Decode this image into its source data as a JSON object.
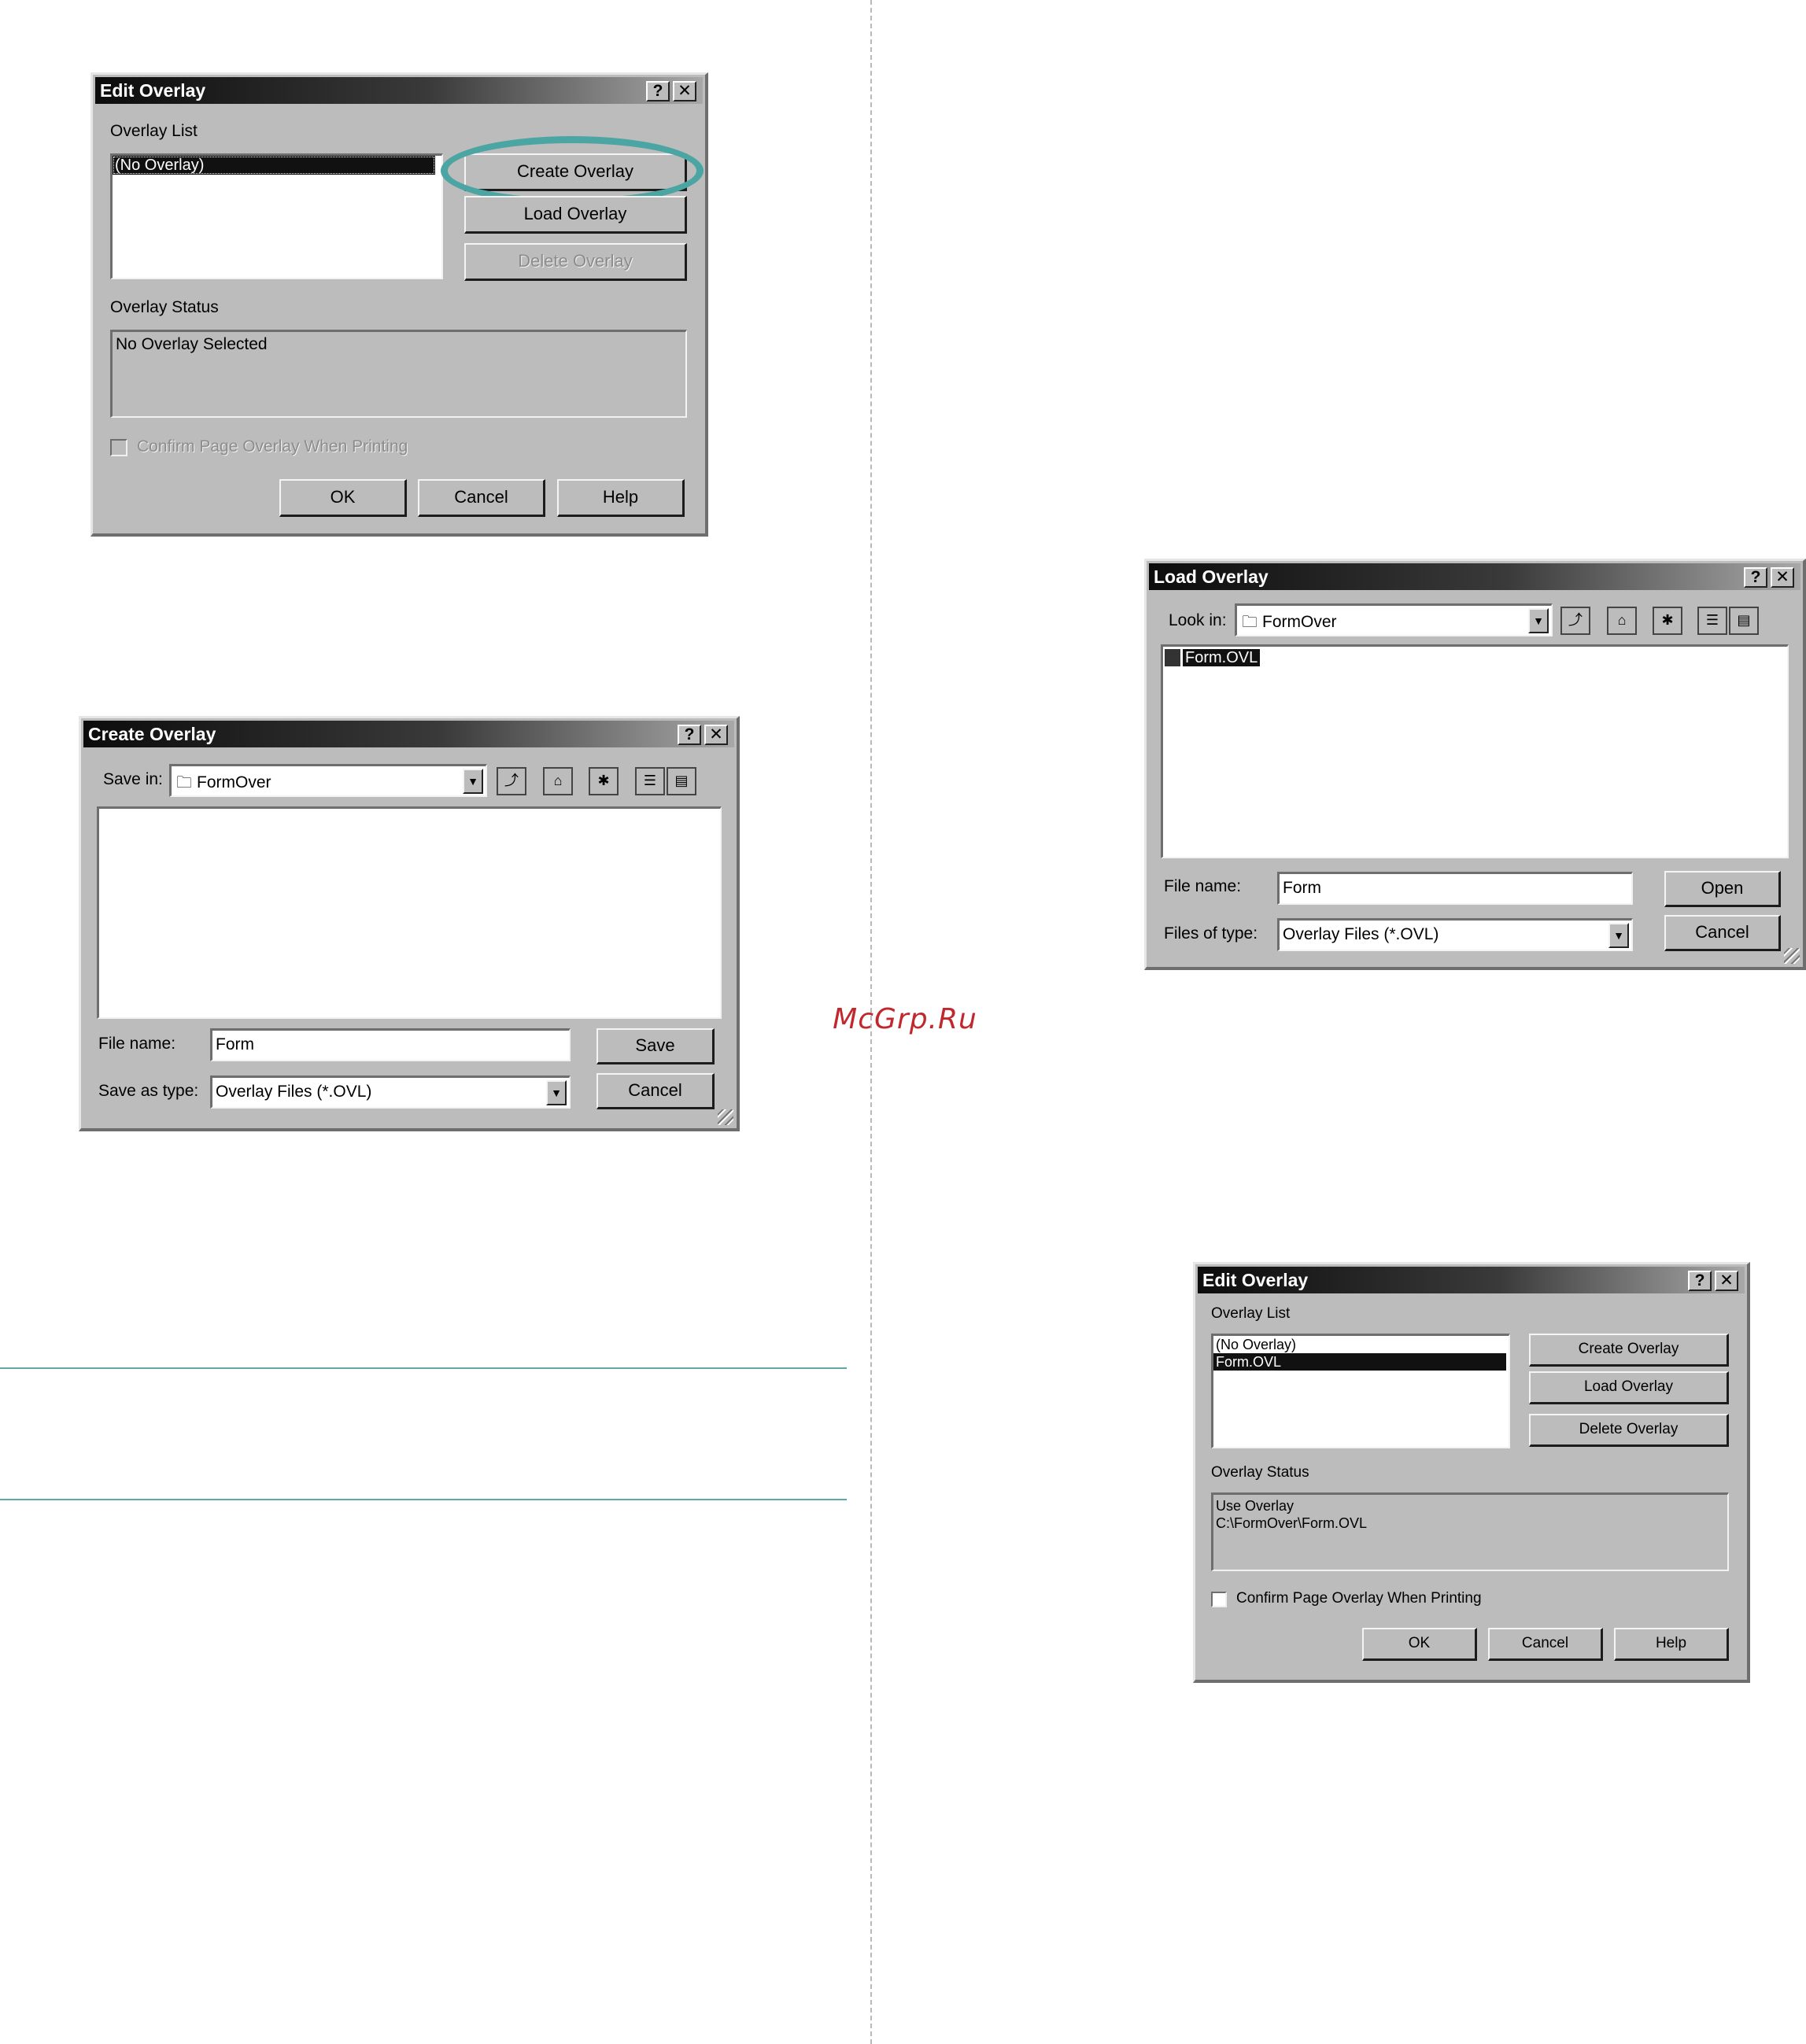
{
  "watermark": "McGrp.Ru",
  "edit_overlay_1": {
    "title": "Edit Overlay",
    "help_btn": "?",
    "close_btn": "✕",
    "overlay_list_label": "Overlay List",
    "list_items": [
      "(No Overlay)"
    ],
    "create_btn": "Create Overlay",
    "load_btn": "Load Overlay",
    "delete_btn": "Delete Overlay",
    "status_label": "Overlay Status",
    "status_text": "No Overlay Selected",
    "confirm_label": "Confirm Page Overlay When Printing",
    "ok_btn": "OK",
    "cancel_btn": "Cancel",
    "help_label": "Help"
  },
  "create_overlay": {
    "title": "Create Overlay",
    "help_btn": "?",
    "close_btn": "✕",
    "save_in_label": "Save in:",
    "save_in_value": "FormOver",
    "file_name_label": "File name:",
    "file_name_value": "Form",
    "save_type_label": "Save as type:",
    "save_type_value": "Overlay Files (*.OVL)",
    "save_btn": "Save",
    "cancel_btn": "Cancel"
  },
  "load_overlay": {
    "title": "Load Overlay",
    "help_btn": "?",
    "close_btn": "✕",
    "look_in_label": "Look in:",
    "look_in_value": "FormOver",
    "files": [
      "Form.OVL"
    ],
    "file_name_label": "File name:",
    "file_name_value": "Form",
    "files_type_label": "Files of type:",
    "files_type_value": "Overlay Files (*.OVL)",
    "open_btn": "Open",
    "cancel_btn": "Cancel"
  },
  "edit_overlay_2": {
    "title": "Edit Overlay",
    "help_btn": "?",
    "close_btn": "✕",
    "overlay_list_label": "Overlay List",
    "list_items": [
      "(No Overlay)",
      "Form.OVL"
    ],
    "create_btn": "Create Overlay",
    "load_btn": "Load Overlay",
    "delete_btn": "Delete Overlay",
    "status_label": "Overlay Status",
    "status_line1": "Use Overlay",
    "status_line2": "C:\\FormOver\\Form.OVL",
    "confirm_label": "Confirm Page Overlay When Printing",
    "ok_btn": "OK",
    "cancel_btn": "Cancel",
    "help_label": "Help"
  },
  "colors": {
    "highlight_ring": "#4aa5a3",
    "section_rule": "#5fa8aa",
    "watermark": "#c0282e"
  }
}
